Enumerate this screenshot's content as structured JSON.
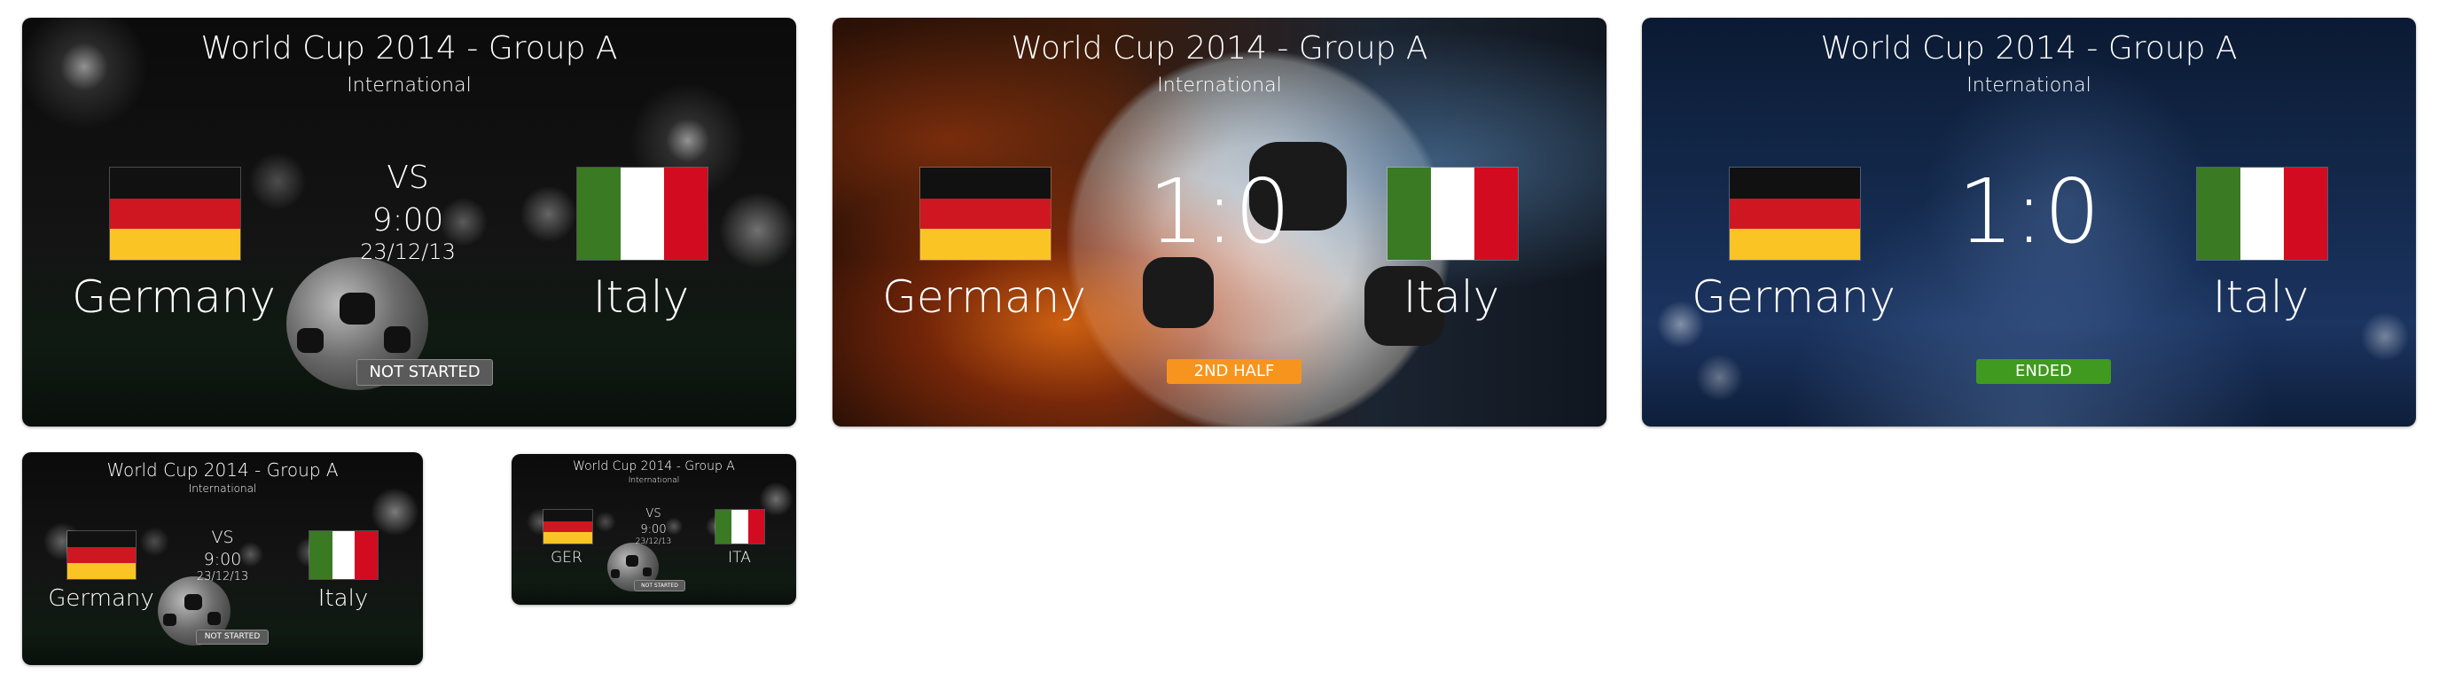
{
  "cards": [
    {
      "title": "World Cup 2014 - Group A",
      "subtitle": "International",
      "home": "Germany",
      "away": "Italy",
      "center_top": "VS",
      "time": "9:00",
      "date": "23/12/13",
      "status": "NOT STARTED",
      "status_color": "#5a5a5a"
    },
    {
      "title": "World Cup 2014 - Group A",
      "subtitle": "International",
      "home": "Germany",
      "away": "Italy",
      "score": "1:0",
      "status": "2ND HALF",
      "status_color": "#f7941d"
    },
    {
      "title": "World Cup 2014 - Group A",
      "subtitle": "International",
      "home": "Germany",
      "away": "Italy",
      "score": "1:0",
      "status": "ENDED",
      "status_color": "#3f9a1f"
    },
    {
      "title": "World Cup 2014 - Group A",
      "subtitle": "International",
      "home": "Germany",
      "away": "Italy",
      "center_top": "VS",
      "time": "9:00",
      "date": "23/12/13",
      "status": "NOT STARTED",
      "status_color": "#5a5a5a"
    },
    {
      "title": "World Cup 2014 - Group A",
      "subtitle": "International",
      "home": "GER",
      "away": "ITA",
      "center_top": "VS",
      "time": "9:00",
      "date": "23/12/13",
      "status": "NOT STARTED",
      "status_color": "#5a5a5a"
    }
  ],
  "flag_colors": {
    "germany": [
      "#111111",
      "#cf1721",
      "#fbc425"
    ],
    "italy": [
      "#3a7a23",
      "#ffffff",
      "#d30b20"
    ]
  }
}
